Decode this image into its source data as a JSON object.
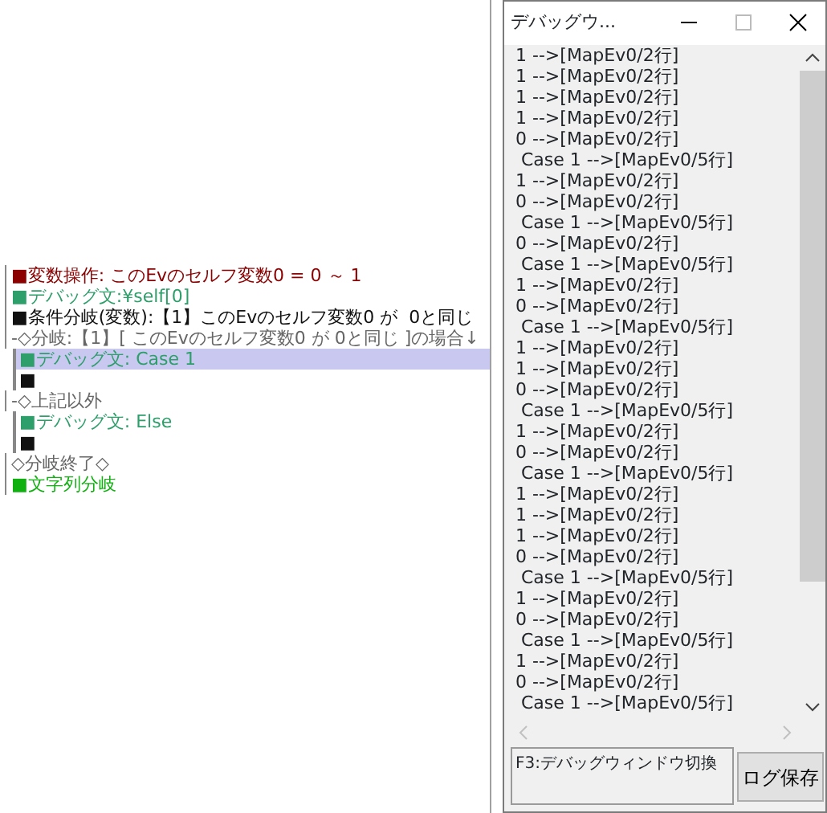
{
  "editor": {
    "lines": [
      {
        "kind": "variable",
        "text": "■変数操作: このEvのセルフ変数0 = 0 ～ 1",
        "selected": false
      },
      {
        "kind": "debug",
        "text": "■デバッグ文:¥self[0]",
        "selected": false
      },
      {
        "kind": "condition",
        "text": "■条件分岐(変数):【1】このEvのセルフ変数0 が  0と同じ",
        "selected": false
      },
      {
        "kind": "branch",
        "text": "-◇分岐:【1】[ このEvのセルフ変数0 が 0と同じ ]の場合↓",
        "selected": false,
        "children": [
          {
            "kind": "debug",
            "text": "■デバッグ文: Case 1",
            "selected": true
          },
          {
            "kind": "empty",
            "text": "■",
            "selected": false
          }
        ]
      },
      {
        "kind": "branch",
        "text": "-◇上記以外",
        "selected": false,
        "children": [
          {
            "kind": "debug",
            "text": "■デバッグ文: Else",
            "selected": false
          },
          {
            "kind": "empty",
            "text": "■",
            "selected": false
          }
        ]
      },
      {
        "kind": "branch",
        "text": "◇分岐終了◇",
        "selected": false
      },
      {
        "kind": "string",
        "text": "■文字列分岐",
        "selected": false
      }
    ]
  },
  "debug_window": {
    "title": "デバッグウ...",
    "log": [
      "1 -->[MapEv0/2行]",
      "1 -->[MapEv0/2行]",
      "1 -->[MapEv0/2行]",
      "1 -->[MapEv0/2行]",
      "0 -->[MapEv0/2行]",
      " Case 1 -->[MapEv0/5行]",
      "1 -->[MapEv0/2行]",
      "0 -->[MapEv0/2行]",
      " Case 1 -->[MapEv0/5行]",
      "0 -->[MapEv0/2行]",
      " Case 1 -->[MapEv0/5行]",
      "1 -->[MapEv0/2行]",
      "0 -->[MapEv0/2行]",
      " Case 1 -->[MapEv0/5行]",
      "1 -->[MapEv0/2行]",
      "1 -->[MapEv0/2行]",
      "0 -->[MapEv0/2行]",
      " Case 1 -->[MapEv0/5行]",
      "1 -->[MapEv0/2行]",
      "0 -->[MapEv0/2行]",
      " Case 1 -->[MapEv0/5行]",
      "1 -->[MapEv0/2行]",
      "1 -->[MapEv0/2行]",
      "1 -->[MapEv0/2行]",
      "0 -->[MapEv0/2行]",
      " Case 1 -->[MapEv0/5行]",
      "1 -->[MapEv0/2行]",
      "0 -->[MapEv0/2行]",
      " Case 1 -->[MapEv0/5行]",
      "1 -->[MapEv0/2行]",
      "0 -->[MapEv0/2行]",
      " Case 1 -->[MapEv0/5行]"
    ],
    "status": "F3:デバッグウィンドウ切換",
    "save_button": "ログ保存"
  }
}
